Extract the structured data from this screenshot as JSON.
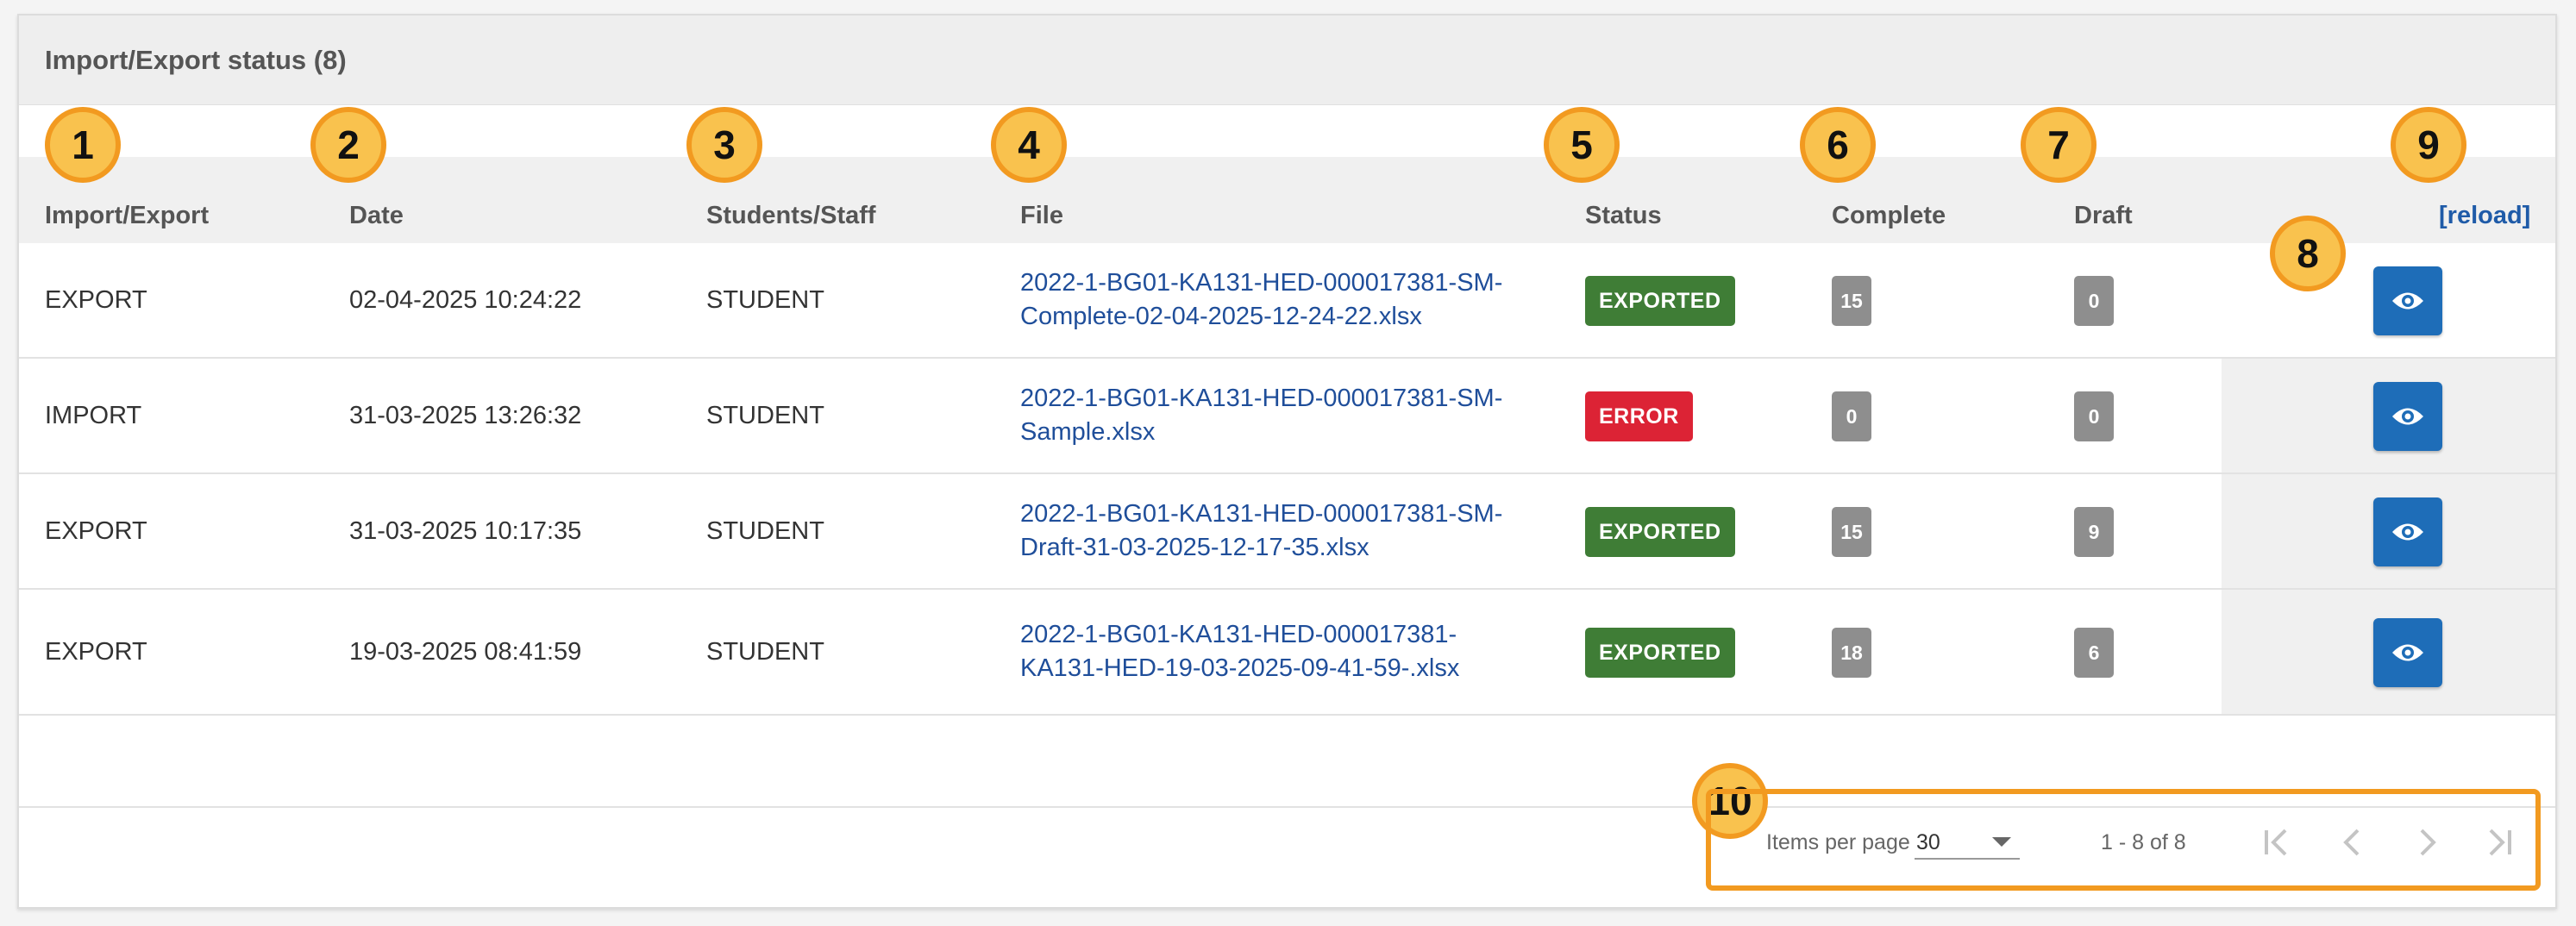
{
  "panel": {
    "title": "Import/Export status (8)"
  },
  "columns": {
    "import_export": "Import/Export",
    "date": "Date",
    "students_staff": "Students/Staff",
    "file": "File",
    "status": "Status",
    "complete": "Complete",
    "draft": "Draft",
    "reload": "[reload]"
  },
  "rows": [
    {
      "type": "EXPORT",
      "date": "02-04-2025 10:24:22",
      "who": "STUDENT",
      "file_line1": "2022-1-BG01-KA131-HED-000017381-SM-",
      "file_line2": "Complete-02-04-2025-12-24-22.xlsx",
      "status": "EXPORTED",
      "complete": "15",
      "draft": "0"
    },
    {
      "type": "IMPORT",
      "date": "31-03-2025 13:26:32",
      "who": "STUDENT",
      "file_line1": "2022-1-BG01-KA131-HED-000017381-SM-",
      "file_line2": "Sample.xlsx",
      "status": "ERROR",
      "complete": "0",
      "draft": "0"
    },
    {
      "type": "EXPORT",
      "date": "31-03-2025 10:17:35",
      "who": "STUDENT",
      "file_line1": "2022-1-BG01-KA131-HED-000017381-SM-",
      "file_line2": "Draft-31-03-2025-12-17-35.xlsx",
      "status": "EXPORTED",
      "complete": "15",
      "draft": "9"
    },
    {
      "type": "EXPORT",
      "date": "19-03-2025 08:41:59",
      "who": "STUDENT",
      "file_line1": "2022-1-BG01-KA131-HED-000017381-",
      "file_line2": "KA131-HED-19-03-2025-09-41-59-.xlsx",
      "status": "EXPORTED",
      "complete": "18",
      "draft": "6"
    }
  ],
  "status_colors": {
    "EXPORTED": "#3f7d36",
    "ERROR": "#dc2335"
  },
  "accent": "#1e6db8",
  "callouts": [
    "1",
    "2",
    "3",
    "4",
    "5",
    "6",
    "7",
    "8",
    "9",
    "10"
  ],
  "paginator": {
    "items_per_page_label": "Items per page",
    "items_per_page_value": "30",
    "range": "1 - 8 of 8",
    "first_icon": "first-page-icon",
    "prev_icon": "chevron-left-icon",
    "next_icon": "chevron-right-icon",
    "last_icon": "last-page-icon"
  },
  "view_icon": "eye-icon"
}
